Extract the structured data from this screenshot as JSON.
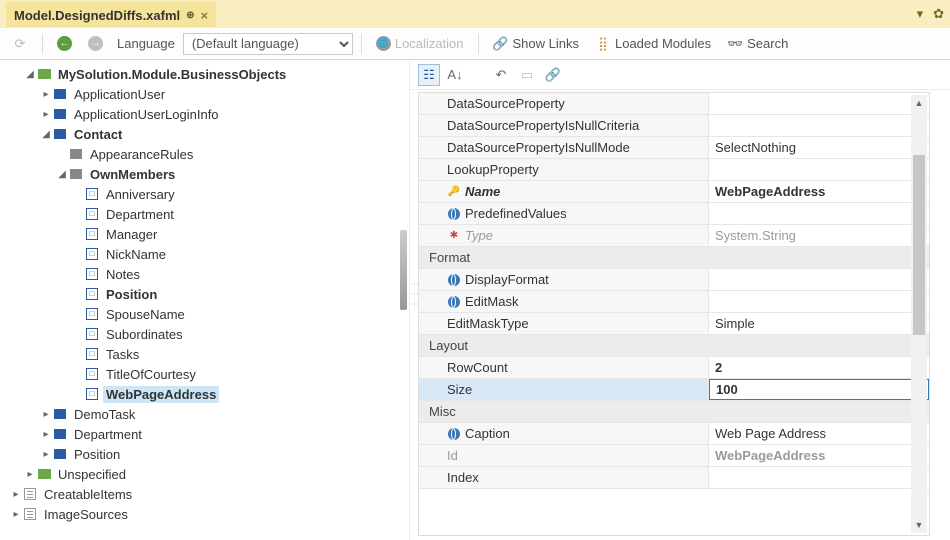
{
  "titlebar": {
    "file": "Model.DesignedDiffs.xafml"
  },
  "toolbar": {
    "language_label": "Language",
    "language_value": "(Default language)",
    "localization": "Localization",
    "show_links": "Show Links",
    "loaded_modules": "Loaded Modules",
    "search": "Search"
  },
  "tree": {
    "root": "MySolution.Module.BusinessObjects",
    "items": [
      "ApplicationUser",
      "ApplicationUserLoginInfo"
    ],
    "contact": "Contact",
    "contact_children": [
      "AppearanceRules"
    ],
    "ownmembers": "OwnMembers",
    "members": [
      "Anniversary",
      "Department",
      "Manager",
      "NickName",
      "Notes",
      "Position",
      "SpouseName",
      "Subordinates",
      "Tasks",
      "TitleOfCourtesy",
      "WebPageAddress"
    ],
    "after_contact": [
      "DemoTask",
      "Department",
      "Position"
    ],
    "other": [
      "Unspecified",
      "CreatableItems",
      "ImageSources"
    ]
  },
  "props": {
    "rows": [
      {
        "name": "DataSourceProperty",
        "val": ""
      },
      {
        "name": "DataSourcePropertyIsNullCriteria",
        "val": ""
      },
      {
        "name": "DataSourcePropertyIsNullMode",
        "val": "SelectNothing"
      },
      {
        "name": "LookupProperty",
        "val": ""
      },
      {
        "name": "Name",
        "val": "WebPageAddress",
        "icon": "key",
        "bold": true,
        "ital": true,
        "vbold": true
      },
      {
        "name": "PredefinedValues",
        "val": "",
        "icon": "globe"
      },
      {
        "name": "Type",
        "val": "System.String",
        "icon": "ast",
        "ital": true,
        "gray": true,
        "vgray": true
      }
    ],
    "cat_format": "Format",
    "format_rows": [
      {
        "name": "DisplayFormat",
        "val": "",
        "icon": "globe"
      },
      {
        "name": "EditMask",
        "val": "",
        "icon": "globe"
      },
      {
        "name": "EditMaskType",
        "val": "Simple"
      }
    ],
    "cat_layout": "Layout",
    "layout_rows": [
      {
        "name": "RowCount",
        "val": "2",
        "vbold": true
      },
      {
        "name": "Size",
        "val": "100",
        "vbold": true,
        "sel": true
      }
    ],
    "cat_misc": "Misc",
    "misc_rows": [
      {
        "name": "Caption",
        "val": "Web Page Address",
        "icon": "globe"
      },
      {
        "name": "Id",
        "val": "WebPageAddress",
        "gray": true,
        "vbold": true,
        "vgray": true
      },
      {
        "name": "Index",
        "val": ""
      }
    ]
  }
}
